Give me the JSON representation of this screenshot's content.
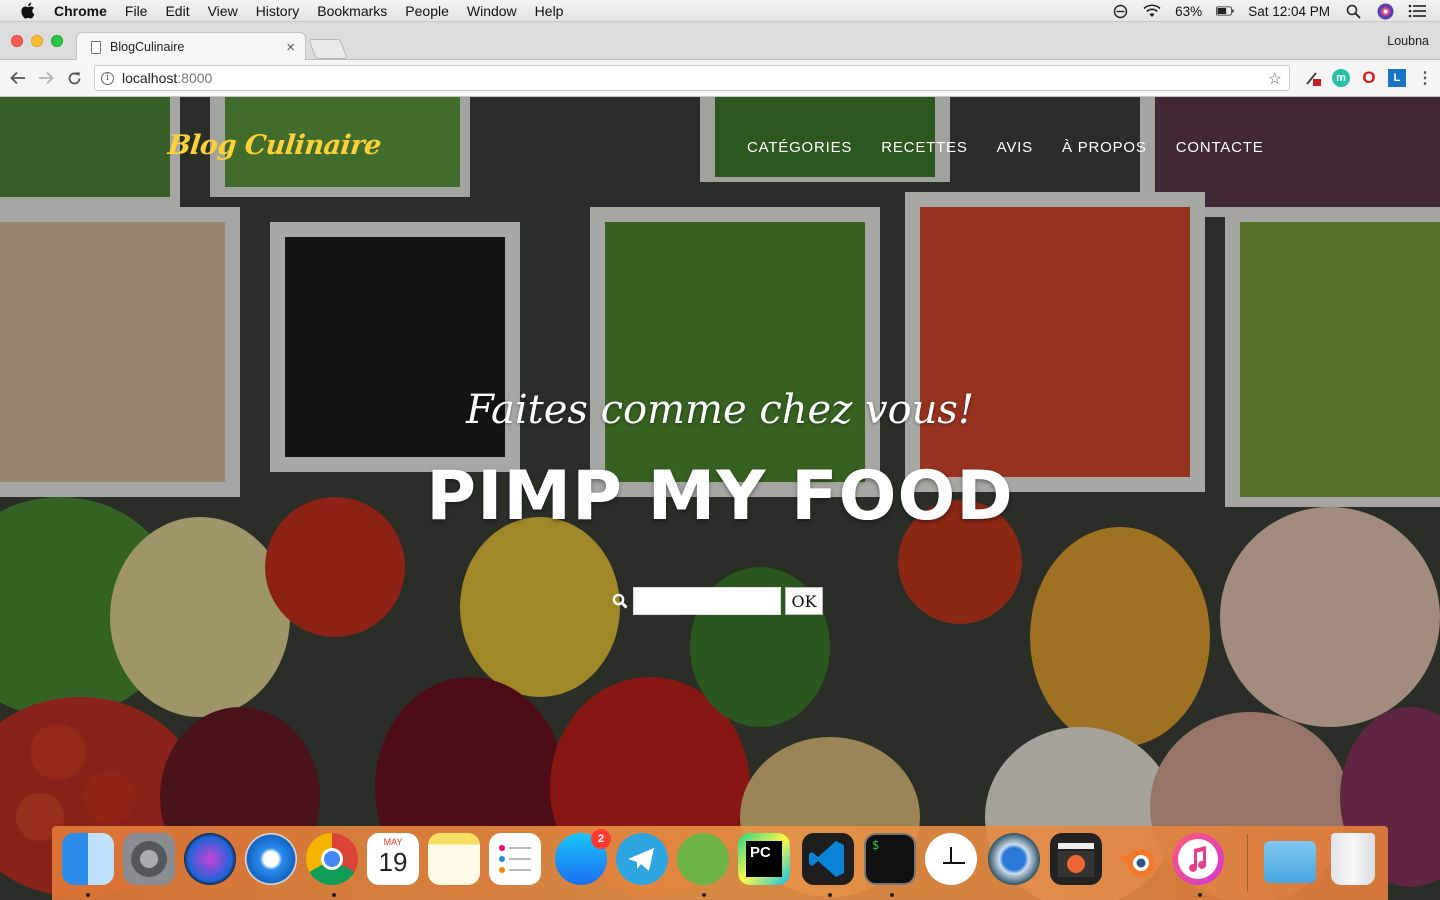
{
  "menubar": {
    "app_name": "Chrome",
    "menus": [
      "File",
      "Edit",
      "View",
      "History",
      "Bookmarks",
      "People",
      "Window",
      "Help"
    ],
    "battery": "63%",
    "clock": "Sat 12:04 PM"
  },
  "browser": {
    "tab_title": "BlogCulinaire",
    "profile": "Loubna",
    "url_host": "localhost",
    "url_port": ":8000"
  },
  "site": {
    "logo": "Blog Culinaire",
    "nav": [
      "CATÉGORIES",
      "RECETTES",
      "AVIS",
      "À PROPOS",
      "CONTACTE"
    ],
    "subtitle": "Faites comme chez vous!",
    "headline": "PIMP MY FOOD",
    "search_value": "",
    "search_button": "OK"
  },
  "dock": {
    "calendar_month": "MAY",
    "calendar_day": "19",
    "appstore_badge": "2",
    "items": [
      "finder-icon",
      "system-preferences-icon",
      "siri-icon",
      "safari-icon",
      "chrome-icon",
      "calendar-icon",
      "notes-icon",
      "reminders-icon",
      "app-store-icon",
      "telegram-icon",
      "android-studio-icon",
      "pycharm-icon",
      "vscode-icon",
      "terminal-icon",
      "clock-icon",
      "quicktime-icon",
      "final-cut-icon",
      "blender-icon",
      "itunes-icon",
      "downloads-folder-icon",
      "trash-icon"
    ]
  },
  "colors": {
    "logo_yellow": "#fed136",
    "menu_bar": "#ececec",
    "dock_orange": "#e88a45"
  }
}
